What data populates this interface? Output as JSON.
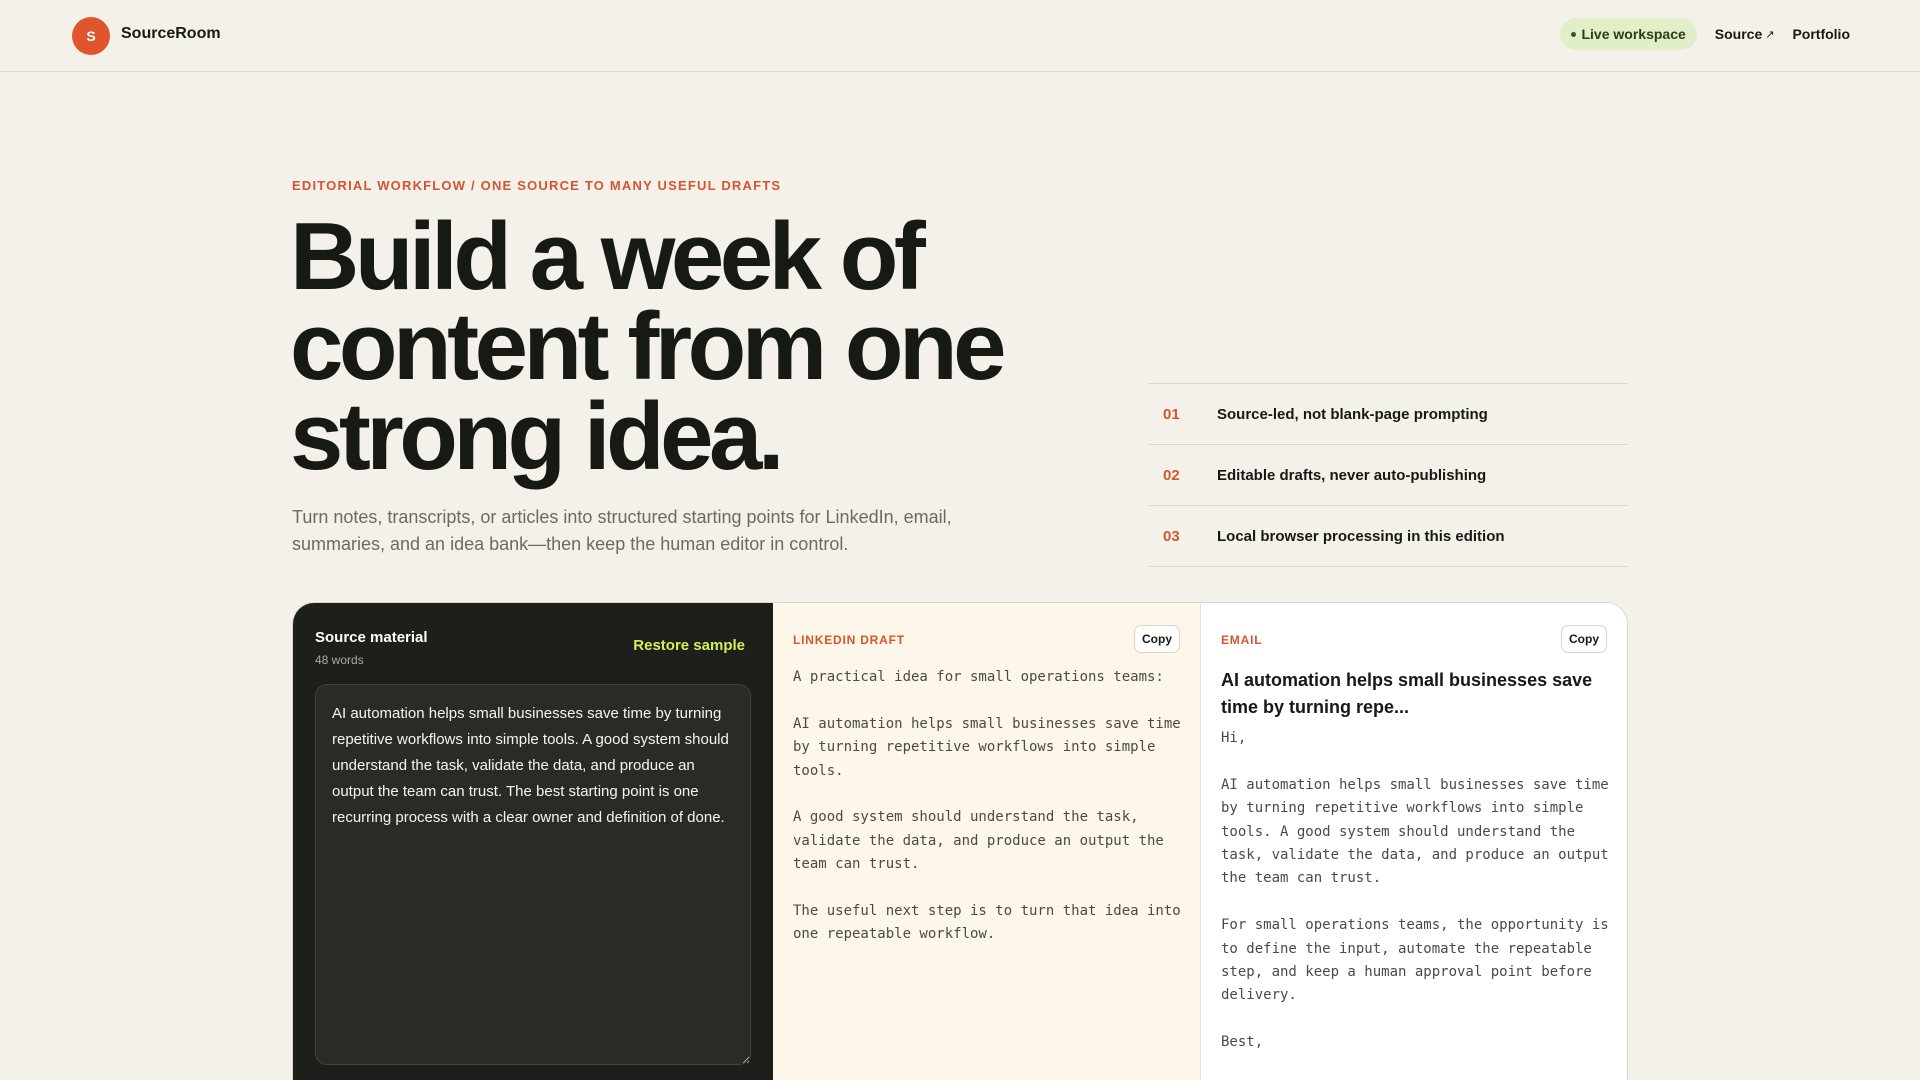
{
  "header": {
    "logo_letter": "S",
    "brand": "SourceRoom",
    "live_label": "Live workspace",
    "source_link": "Source",
    "source_link_icon": "↗",
    "portfolio_link": "Portfolio"
  },
  "hero": {
    "eyebrow": "EDITORIAL WORKFLOW / ONE SOURCE TO MANY USEFUL DRAFTS",
    "headline_line1": "Build a week of",
    "headline_line2": "content from one",
    "headline_line3": "strong idea.",
    "subhead": "Turn notes, transcripts, or articles into structured starting points for LinkedIn, email, summaries, and an idea bank—then keep the human editor in control."
  },
  "features": [
    {
      "num": "01",
      "text": "Source-led, not blank-page prompting"
    },
    {
      "num": "02",
      "text": "Editable drafts, never auto-publishing"
    },
    {
      "num": "03",
      "text": "Local browser processing in this edition"
    }
  ],
  "source": {
    "title": "Source material",
    "word_count": "48 words",
    "restore_label": "Restore sample",
    "text": "AI automation helps small businesses save time by turning repetitive workflows into simple tools. A good system should understand the task, validate the data, and produce an output the team can trust. The best starting point is one recurring process with a clear owner and definition of done."
  },
  "linkedin": {
    "label": "LINKEDIN DRAFT",
    "copy_label": "Copy",
    "body": "A practical idea for small operations teams:\n\nAI automation helps small businesses save time by turning repetitive workflows into simple tools.\n\nA good system should understand the task, validate the data, and produce an output the team can trust.\n\nThe useful next step is to turn that idea into one repeatable workflow."
  },
  "email": {
    "label": "EMAIL",
    "copy_label": "Copy",
    "subject": "AI automation helps small businesses save time by turning repe...",
    "body": "Hi,\n\nAI automation helps small businesses save time by turning repetitive workflows into simple tools. A good system should understand the task, validate the data, and produce an output the team can trust.\n\nFor small operations teams, the opportunity is to define the input, automate the repeatable step, and keep a human approval point before delivery.\n\nBest,"
  },
  "colors": {
    "accent": "#e0552e",
    "lime": "#d4ee5a",
    "dark_panel": "#1c1f1a",
    "background": "#f4f1ea"
  }
}
